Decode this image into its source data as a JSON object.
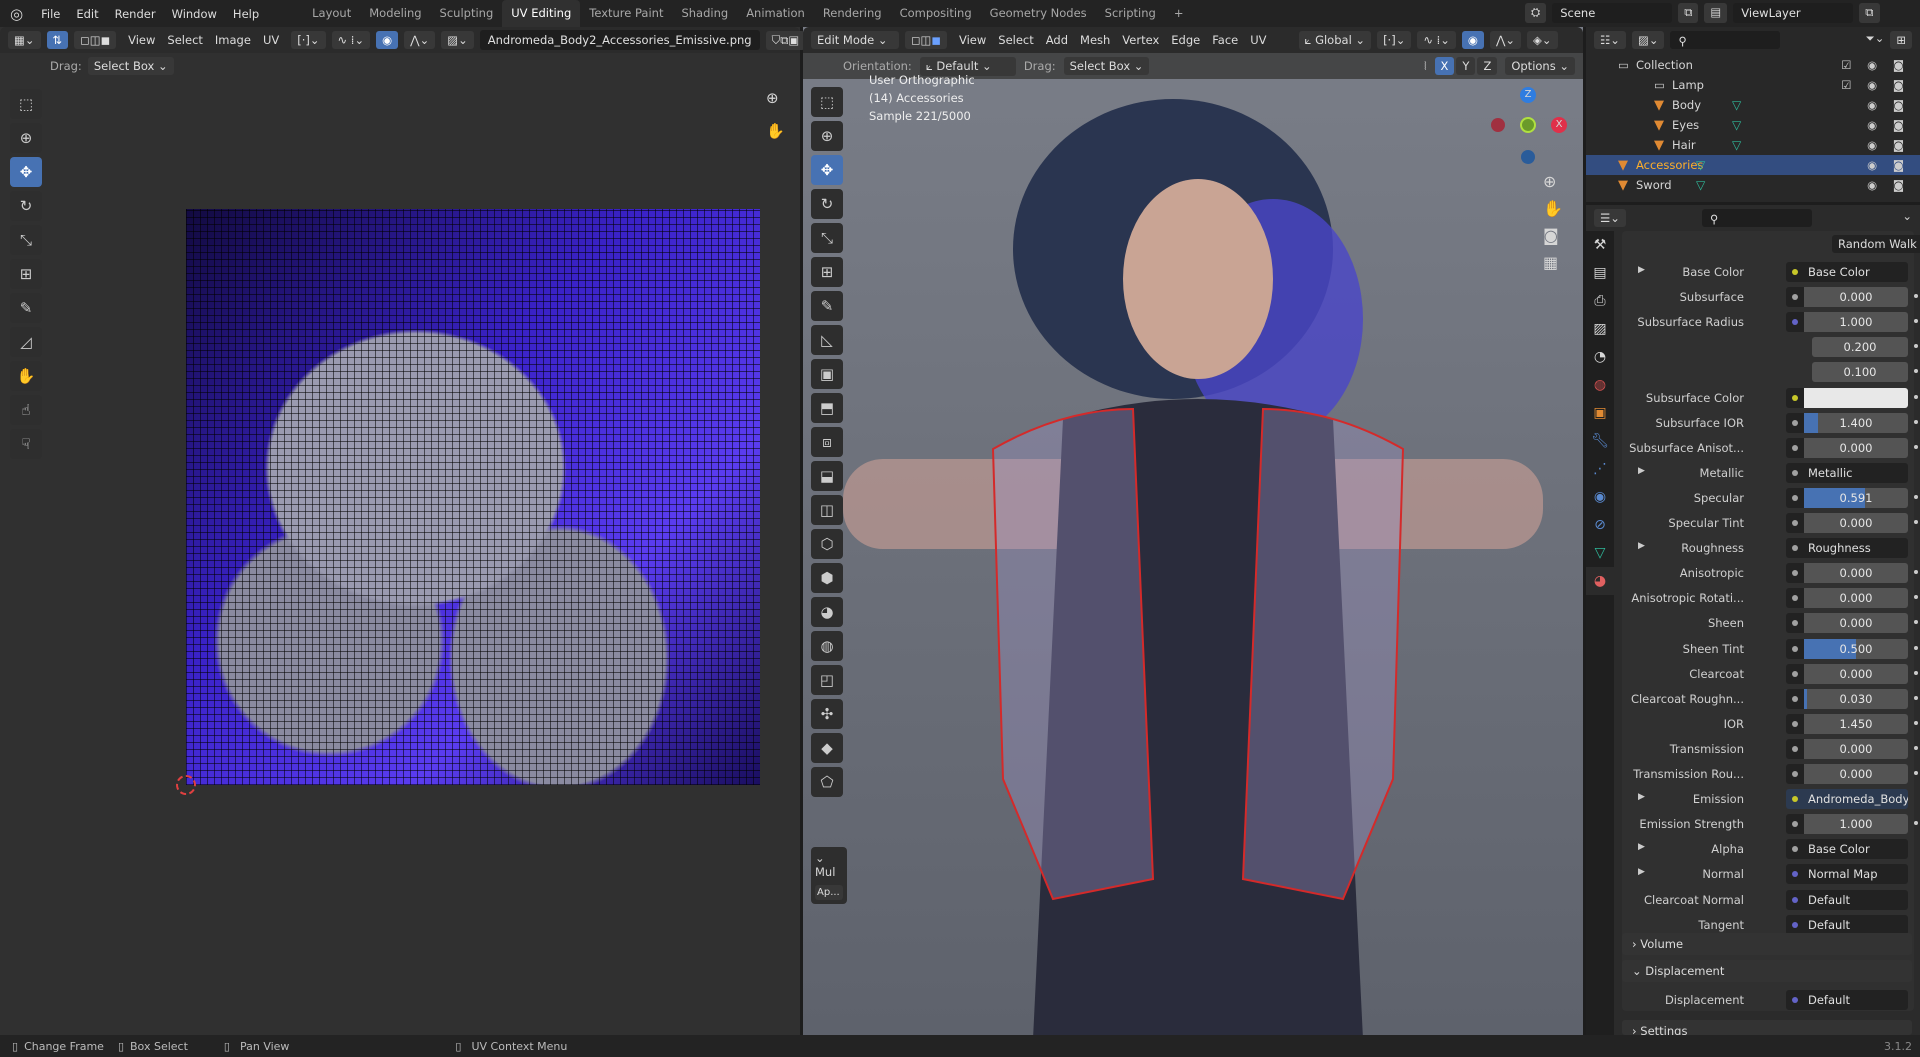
{
  "topbar": {
    "menus": [
      "File",
      "Edit",
      "Render",
      "Window",
      "Help"
    ],
    "workspaces": [
      "Layout",
      "Modeling",
      "Sculpting",
      "UV Editing",
      "Texture Paint",
      "Shading",
      "Animation",
      "Rendering",
      "Compositing",
      "Geometry Nodes",
      "Scripting"
    ],
    "active_workspace": "UV Editing",
    "add_tab": "+",
    "scene": "Scene",
    "view_layer": "ViewLayer"
  },
  "uv_editor": {
    "menus": [
      "View",
      "Select",
      "Image",
      "UV"
    ],
    "image_name": "Andromeda_Body2_Accessories_Emissive.png",
    "drag_label": "Drag:",
    "drag_value": "Select Box"
  },
  "viewport": {
    "mode": "Edit Mode",
    "menus": [
      "View",
      "Select",
      "Add",
      "Mesh",
      "Vertex",
      "Edge",
      "Face",
      "UV"
    ],
    "transform_orientation": "Global",
    "orientation_label": "Orientation:",
    "orientation_value": "Default",
    "drag_label": "Drag:",
    "drag_value": "Select Box",
    "axes": [
      "X",
      "Y",
      "Z"
    ],
    "options": "Options",
    "overlay": [
      "User Orthographic",
      "(14) Accessories",
      "Sample 221/5000"
    ],
    "gizmo": {
      "z": "Z",
      "x": "X"
    },
    "last_op": {
      "title": "Mul",
      "button": "Ap..."
    }
  },
  "outliner": {
    "items": [
      {
        "name": "Collection",
        "kind": "collection"
      },
      {
        "name": "Lamp",
        "kind": "collection"
      },
      {
        "name": "Body",
        "kind": "mesh"
      },
      {
        "name": "Eyes",
        "kind": "mesh"
      },
      {
        "name": "Hair",
        "kind": "mesh"
      },
      {
        "name": "Accessories",
        "kind": "mesh",
        "selected": true
      },
      {
        "name": "Sword",
        "kind": "mesh"
      }
    ]
  },
  "properties": {
    "subsurface_method": "Random Walk",
    "rows": [
      {
        "label": "Base Color",
        "type": "link",
        "value": "Base Color",
        "socket": "#c7c729",
        "expand": true
      },
      {
        "label": "Subsurface",
        "type": "value",
        "value": "0.000",
        "fill": 0,
        "socket": "#a1a1a1"
      },
      {
        "label": "Subsurface Radius",
        "type": "value",
        "value": "1.000",
        "fill": 0,
        "socket": "#6363c7"
      },
      {
        "label": "",
        "type": "value",
        "value": "0.200",
        "fill": 0
      },
      {
        "label": "",
        "type": "value",
        "value": "0.100",
        "fill": 0
      },
      {
        "label": "Subsurface Color",
        "type": "color",
        "value": "#e8e8e8",
        "socket": "#c7c729"
      },
      {
        "label": "Subsurface IOR",
        "type": "value",
        "value": "1.400",
        "fill": 0.13,
        "socket": "#a1a1a1"
      },
      {
        "label": "Subsurface Anisot...",
        "type": "value",
        "value": "0.000",
        "fill": 0,
        "socket": "#a1a1a1"
      },
      {
        "label": "Metallic",
        "type": "link",
        "value": "Metallic",
        "socket": "#a1a1a1",
        "expand": true
      },
      {
        "label": "Specular",
        "type": "value",
        "value": "0.591",
        "fill": 0.591,
        "socket": "#a1a1a1"
      },
      {
        "label": "Specular Tint",
        "type": "value",
        "value": "0.000",
        "fill": 0,
        "socket": "#a1a1a1"
      },
      {
        "label": "Roughness",
        "type": "link",
        "value": "Roughness",
        "socket": "#a1a1a1",
        "expand": true
      },
      {
        "label": "Anisotropic",
        "type": "value",
        "value": "0.000",
        "fill": 0,
        "socket": "#a1a1a1"
      },
      {
        "label": "Anisotropic Rotati...",
        "type": "value",
        "value": "0.000",
        "fill": 0,
        "socket": "#a1a1a1"
      },
      {
        "label": "Sheen",
        "type": "value",
        "value": "0.000",
        "fill": 0,
        "socket": "#a1a1a1"
      },
      {
        "label": "Sheen Tint",
        "type": "value",
        "value": "0.500",
        "fill": 0.5,
        "socket": "#a1a1a1"
      },
      {
        "label": "Clearcoat",
        "type": "value",
        "value": "0.000",
        "fill": 0,
        "socket": "#a1a1a1"
      },
      {
        "label": "Clearcoat Roughn...",
        "type": "value",
        "value": "0.030",
        "fill": 0.03,
        "socket": "#a1a1a1"
      },
      {
        "label": "IOR",
        "type": "value",
        "value": "1.450",
        "fill": 0,
        "socket": "#a1a1a1"
      },
      {
        "label": "Transmission",
        "type": "value",
        "value": "0.000",
        "fill": 0,
        "socket": "#a1a1a1"
      },
      {
        "label": "Transmission Rou...",
        "type": "value",
        "value": "0.000",
        "fill": 0,
        "socket": "#a1a1a1"
      },
      {
        "label": "Emission",
        "type": "link",
        "value": "Andromeda_Body2_Acc...",
        "socket": "#c7c729",
        "expand": true,
        "highlight": true
      },
      {
        "label": "Emission Strength",
        "type": "value",
        "value": "1.000",
        "fill": 0,
        "socket": "#a1a1a1"
      },
      {
        "label": "Alpha",
        "type": "link",
        "value": "Base Color",
        "socket": "#a1a1a1",
        "expand": true
      },
      {
        "label": "Normal",
        "type": "link",
        "value": "Normal Map",
        "socket": "#6363c7",
        "expand": true
      },
      {
        "label": "Clearcoat Normal",
        "type": "link",
        "value": "Default",
        "socket": "#6363c7"
      },
      {
        "label": "Tangent",
        "type": "link",
        "value": "Default",
        "socket": "#6363c7"
      }
    ],
    "panels": {
      "volume": "Volume",
      "displacement": "Displacement",
      "settings": "Settings"
    },
    "displacement_row": {
      "label": "Displacement",
      "value": "Default"
    }
  },
  "status": {
    "items": [
      "Change Frame",
      "Box Select",
      "Pan View",
      "UV Context Menu"
    ],
    "version": "3.1.2"
  },
  "colors": {
    "accent": "#4772b3",
    "uv_bg": "#3a22c8",
    "viewport_bg": "#6c707a",
    "wire": "#d42a2a"
  }
}
